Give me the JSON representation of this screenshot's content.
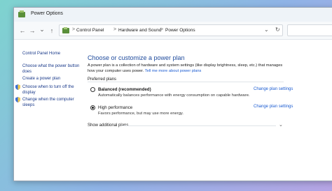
{
  "window": {
    "title": "Power Options",
    "icon": "power-options-icon"
  },
  "nav": {
    "back_icon": "←",
    "forward_icon": "→",
    "down_icon": "⌄",
    "up_icon": "↑",
    "breadcrumbs": [
      "Control Panel",
      "Hardware and Sound",
      "Power Options"
    ],
    "separator": ">",
    "dropdown_icon": "⌄",
    "refresh_icon": "↻"
  },
  "sidebar": {
    "items": [
      {
        "label": "Control Panel Home",
        "icon": ""
      },
      {
        "label": "Choose what the power button does",
        "icon": ""
      },
      {
        "label": "Create a power plan",
        "icon": ""
      },
      {
        "label": "Choose when to turn off the display",
        "icon": "shield-icon"
      },
      {
        "label": "Change when the computer sleeps",
        "icon": "shield-icon"
      }
    ]
  },
  "main": {
    "heading": "Choose or customize a power plan",
    "description": "A power plan is a collection of hardware and system settings (like display brightness, sleep, etc.) that manages how your computer uses power. ",
    "description_link": "Tell me more about power plans",
    "section_label": "Preferred plans",
    "plans": [
      {
        "name": "Balanced (recommended)",
        "description": "Automatically balances performance with energy consumption on capable hardware.",
        "link": "Change plan settings",
        "selected": false
      },
      {
        "name": "High performance",
        "description": "Favors performance, but may use more energy.",
        "link": "Change plan settings",
        "selected": true
      }
    ],
    "show_additional": "Show additional plans"
  }
}
